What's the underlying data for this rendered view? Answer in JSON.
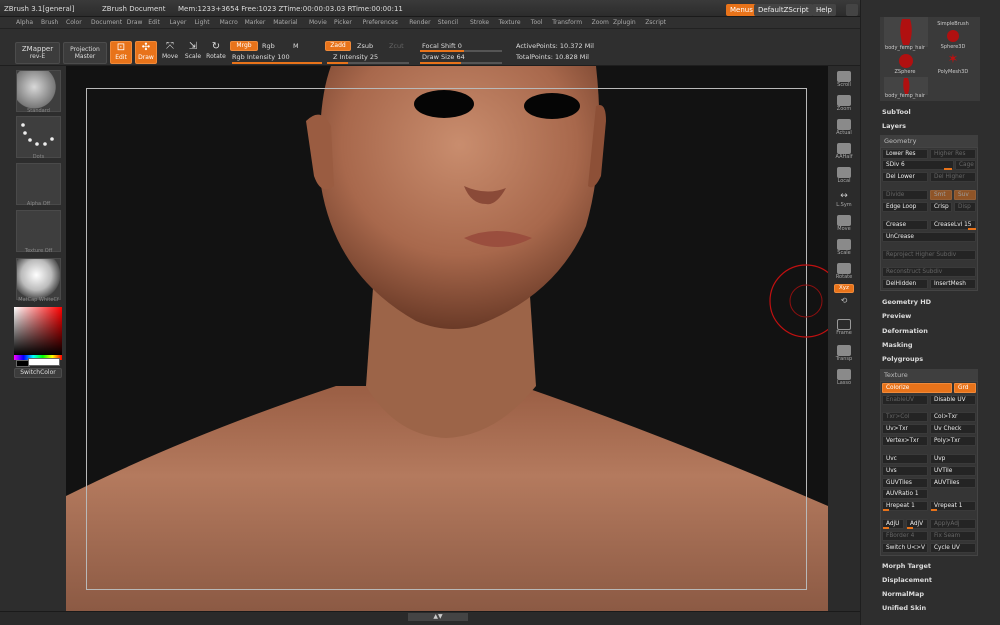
{
  "app": {
    "title": "ZBrush  3.1[general]",
    "document": "ZBrush Document",
    "mem": "Mem:1233+3654 Free:1023 ZTime:00:00:03.03 RTime:00:00:11",
    "menus_label": "Menus",
    "script_label": "DefaultZScript",
    "help_label": "Help"
  },
  "menubar": [
    "Alpha",
    "Brush",
    "Color",
    "Document",
    "Draw",
    "Edit",
    "Layer",
    "Light",
    "Macro",
    "Marker",
    "Material",
    "Movie",
    "Picker",
    "Preferences",
    "Render",
    "Stencil",
    "Stroke",
    "Texture",
    "Tool",
    "Transform",
    "Zoom",
    "Zplugin",
    "Zscript"
  ],
  "toolbar": {
    "zmapper": "ZMapper",
    "zmapper_sub": "rev-E",
    "projection": "Projection",
    "projection_sub": "Master",
    "edit": "Edit",
    "draw": "Draw",
    "move": "Move",
    "scale": "Scale",
    "rotate": "Rotate",
    "mrgb": "Mrgb",
    "rgb": "Rgb",
    "m": "M",
    "rgb_intensity": "Rgb Intensity 100",
    "zadd": "Zadd",
    "zsub": "Zsub",
    "zcut": "Zcut",
    "z_intensity": "Z Intensity 25",
    "focal_shift": "Focal Shift 0",
    "draw_size": "Draw Size 64",
    "active_points": "ActivePoints: 10.372 Mil",
    "total_points": "TotalPoints: 10.828 Mil"
  },
  "toolbar_values": {
    "rgb_intensity": 100,
    "z_intensity": 25,
    "draw_size": 64
  },
  "left": {
    "brush": "Standard",
    "stroke": "Dots",
    "alpha": "Alpha Off",
    "texture": "Texture Off",
    "material": "MatCap WhiteCf",
    "switch_color": "SwitchColor"
  },
  "rightstrip": [
    "Scroll",
    "Zoom",
    "Actual",
    "AAHalf",
    "Local",
    "L.Sym",
    "Move",
    "Scale",
    "Rotate",
    "Xyz",
    "",
    "Frame",
    "Transp",
    "Lasso"
  ],
  "tray": {
    "thumbs": [
      "body_femp_hair",
      "SimpleBrush",
      "Sphere3D",
      "ZSphere",
      "PolyMesh3D",
      "body_femp_hair"
    ],
    "subtool": "SubTool",
    "layers": "Layers",
    "geometry": "Geometry",
    "lower_res": "Lower Res",
    "higher_res": "Higher Res",
    "sdiv": "SDiv 6",
    "cage": "Cage",
    "del_lower": "Del Lower",
    "del_higher": "Del Higher",
    "divide": "Divide",
    "smt": "Smt",
    "suv": "Suv",
    "edge_loop": "Edge Loop",
    "crisp": "Crisp",
    "disp": "Disp",
    "crease": "Crease",
    "creaselvl": "CreaseLvl 15",
    "uncrease": "UnCrease",
    "reproject": "Reproject Higher Subdiv",
    "reconstruct": "Reconstruct Subdiv",
    "delhidden": "DelHidden",
    "insertmesh": "InsertMesh",
    "geometry_hd": "Geometry HD",
    "preview": "Preview",
    "deformation": "Deformation",
    "masking": "Masking",
    "polygroups": "Polygroups",
    "texture": "Texture",
    "colorize": "Colorize",
    "grd": "Grd",
    "enableuv": "EnableUV",
    "disableuv": "Disable UV",
    "txr_col": "Txr>Col",
    "col_txr": "Col>Txr",
    "uv_txr": "Uv>Txr",
    "uv_check": "Uv Check",
    "vertex_txr": "Vertex>Txr",
    "poly_txr": "Poly>Txr",
    "uvc": "Uvc",
    "uvp": "Uvp",
    "uvs": "Uvs",
    "uvtile": "UVTile",
    "guvtiles": "GUVTiles",
    "auvtiles": "AUVTiles",
    "auvratio": "AUVRatio 1",
    "hrepeat": "Hrepeat 1",
    "vrepeat": "Vrepeat 1",
    "adju": "AdjU",
    "adjv": "AdjV",
    "applyadj": "ApplyAdj",
    "fborder": "FBorder 4",
    "fix_seam": "Fix Seam",
    "switch_uv": "Switch U<>V",
    "cycle_uv": "Cycle UV",
    "morph_target": "Morph Target",
    "displacement": "Displacement",
    "normalmap": "NormalMap",
    "unified_skin": "Unified Skin"
  },
  "colors": {
    "accent": "#e8731a",
    "panel": "#2e2e2e",
    "viewport": "#121212",
    "skin": "#b97a5e"
  }
}
